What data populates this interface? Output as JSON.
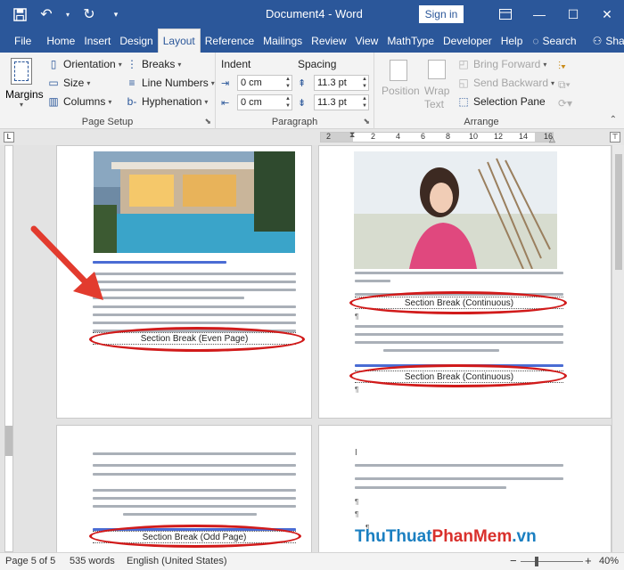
{
  "window": {
    "title": "Document4 - Word",
    "sign_in": "Sign in",
    "icons": [
      "save-icon",
      "undo-icon",
      "redo-icon",
      "customize-icon",
      "ribbon-display-icon",
      "minimize-icon",
      "maximize-icon",
      "close-icon"
    ]
  },
  "tabs": [
    "File",
    "Home",
    "Insert",
    "Design",
    "Layout",
    "Reference",
    "Mailings",
    "Review",
    "View",
    "MathType",
    "Developer",
    "Help"
  ],
  "active_tab": "Layout",
  "tell_me": "Search",
  "share": "Share",
  "ribbon": {
    "page_setup": {
      "label": "Page Setup",
      "margins": "Margins",
      "orientation": "Orientation",
      "size": "Size",
      "columns": "Columns",
      "breaks": "Breaks",
      "line_numbers": "Line Numbers",
      "hyphenation": "Hyphenation"
    },
    "paragraph": {
      "label": "Paragraph",
      "indent_title": "Indent",
      "spacing_title": "Spacing",
      "indent_left": "0 cm",
      "indent_right": "0 cm",
      "spacing_before": "11.3 pt",
      "spacing_after": "11.3 pt"
    },
    "arrange": {
      "label": "Arrange",
      "position": "Position",
      "wrap_text_1": "Wrap",
      "wrap_text_2": "Text",
      "bring_forward": "Bring Forward",
      "send_backward": "Send Backward",
      "selection_pane": "Selection Pane"
    }
  },
  "ruler": {
    "ticks": [
      "2",
      "2",
      "4",
      "6",
      "8",
      "10",
      "12",
      "14",
      "16"
    ]
  },
  "pages": {
    "page1_section_break": "Section Break (Even Page)",
    "page2_section_break_1": "Section Break (Continuous)",
    "page2_section_break_2": "Section Break (Continuous)",
    "page3_section_break": "Section Break (Odd Page)",
    "annotation_color": "#d11a1a",
    "link_color": "#4a6cd4"
  },
  "status": {
    "page": "Page 5 of 5",
    "words": "535 words",
    "language": "English (United States)",
    "zoom": "40%",
    "zoom_minus": "−",
    "zoom_plus": "+"
  },
  "watermark": {
    "part1": "ThuThuat",
    "part2": "PhanMem",
    "part3": ".vn"
  }
}
